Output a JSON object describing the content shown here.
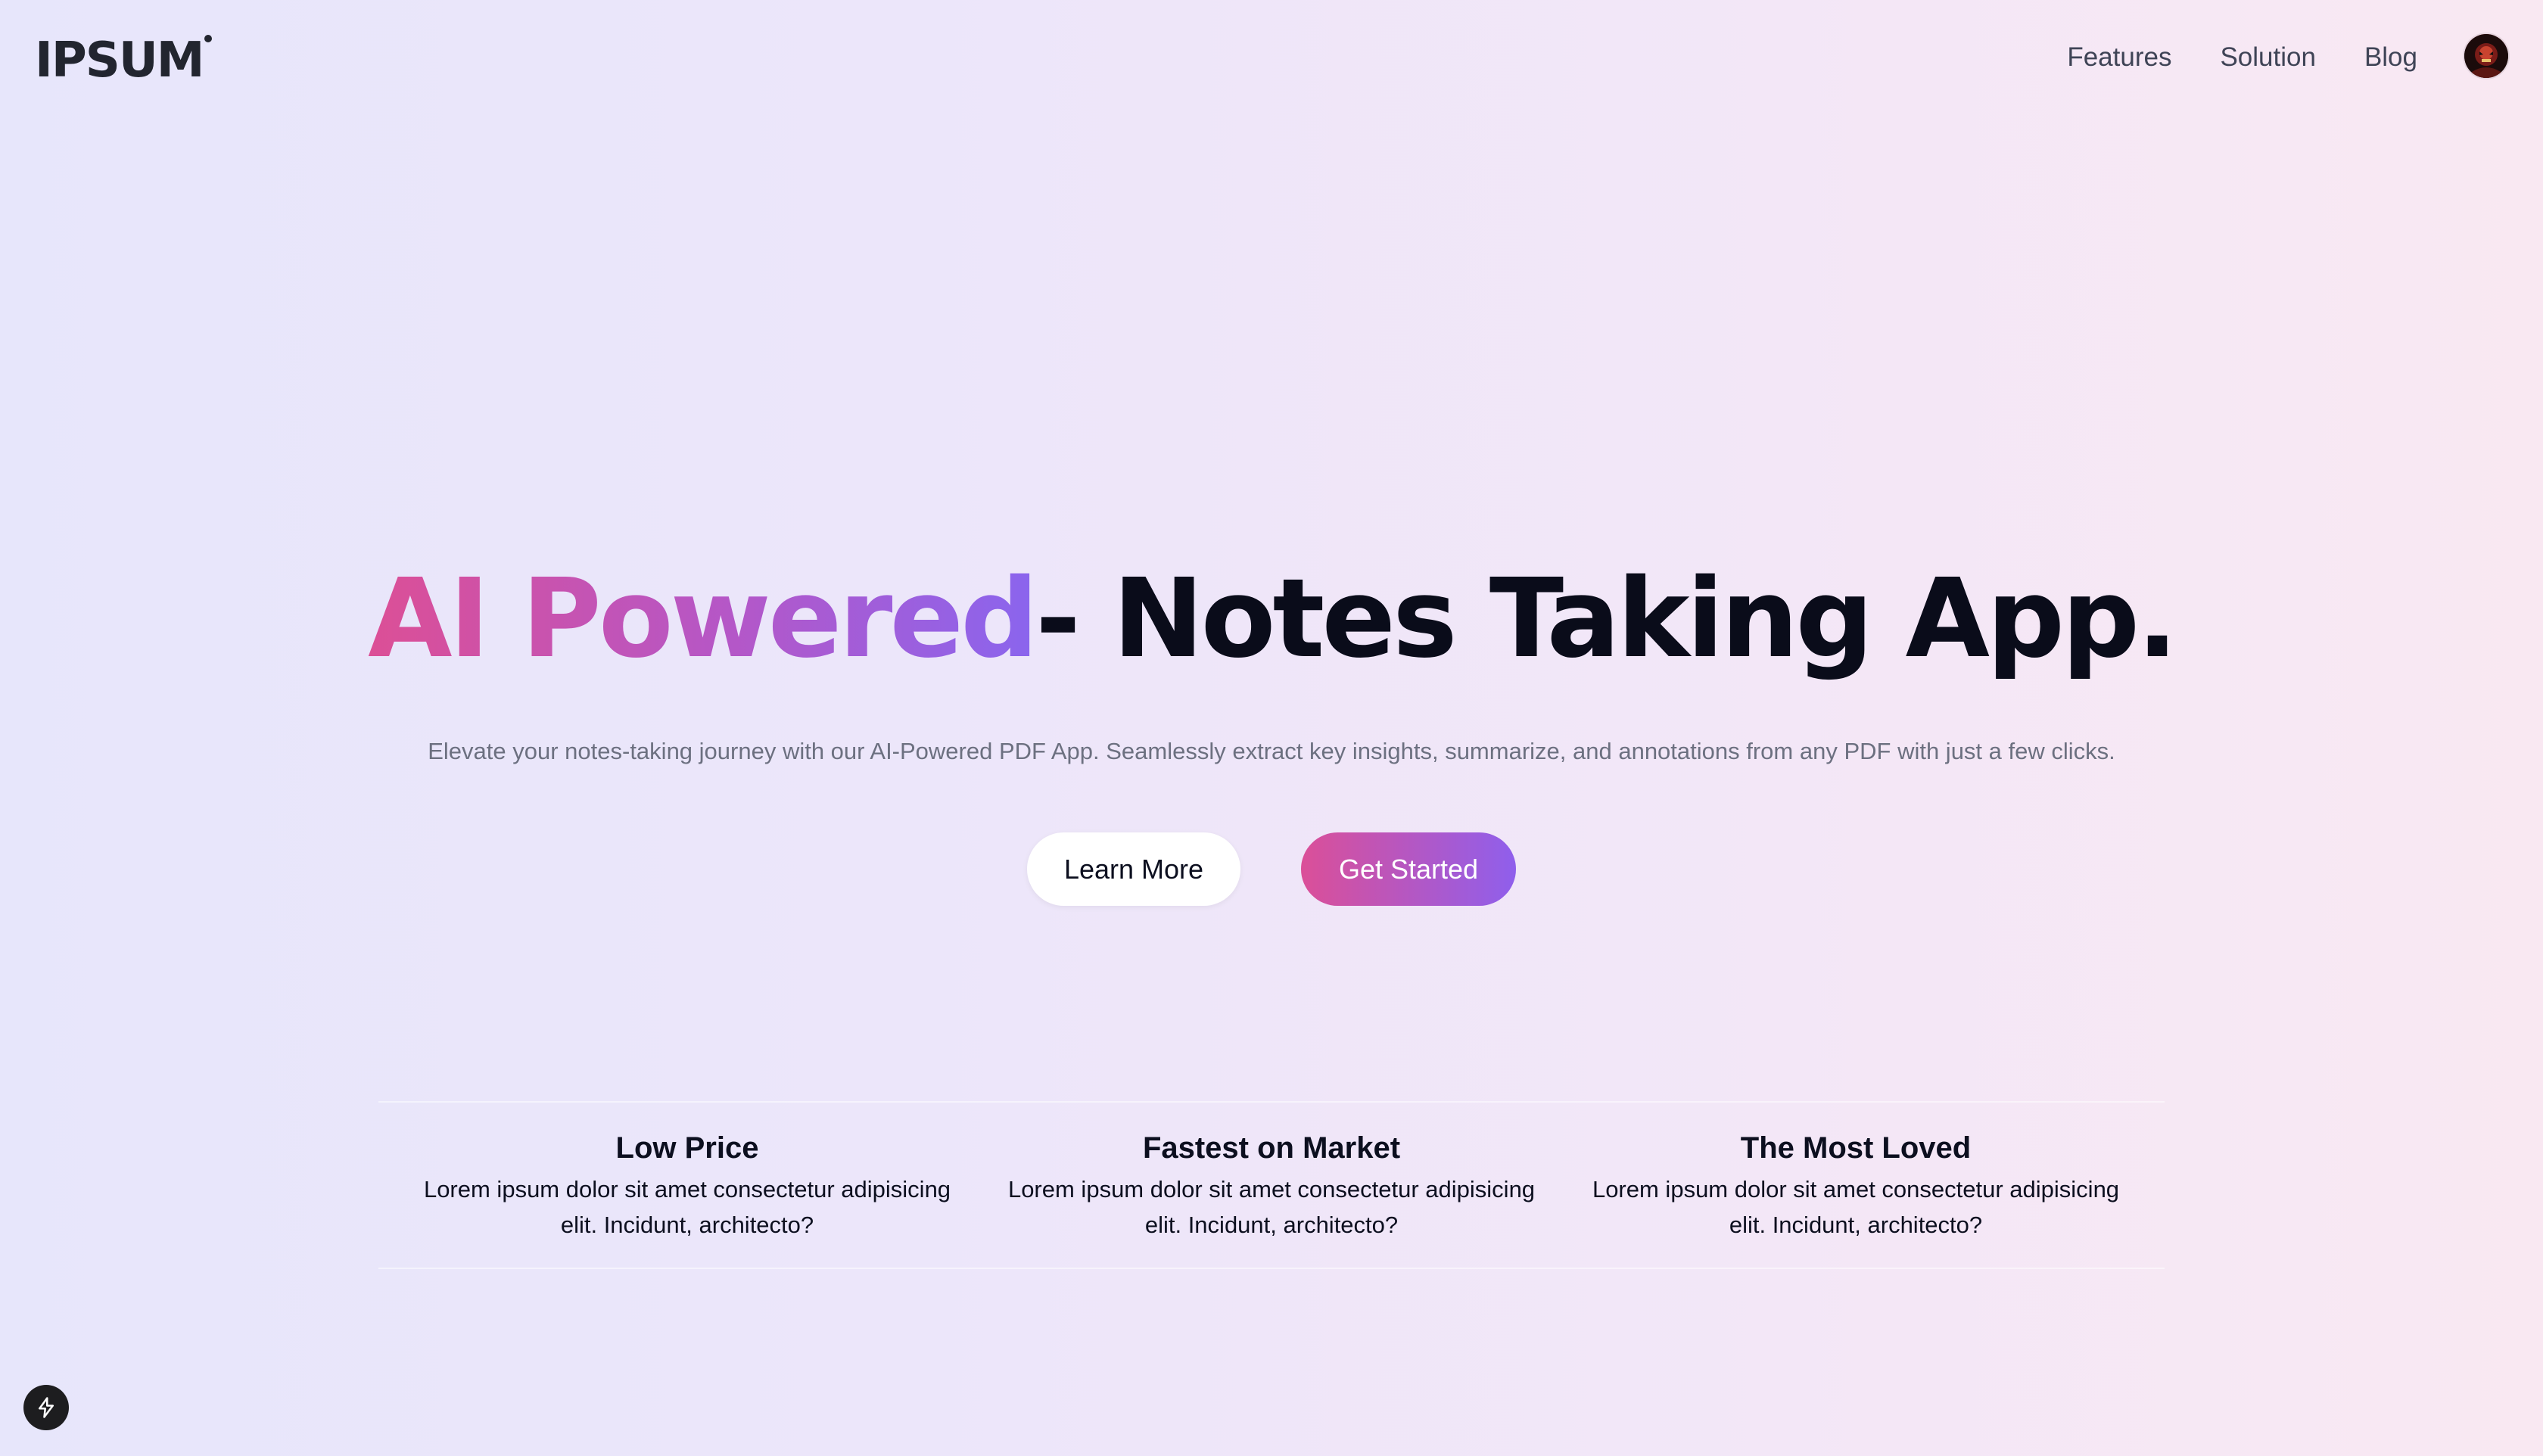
{
  "header": {
    "logo_text": "IPSUM",
    "nav": [
      {
        "label": "Features"
      },
      {
        "label": "Solution"
      },
      {
        "label": "Blog"
      }
    ]
  },
  "hero": {
    "title_highlight": "AI Powered",
    "title_rest": "- Notes Taking App.",
    "subtitle": "Elevate your notes-taking journey with our AI-Powered PDF App. Seamlessly extract key insights, summarize, and annotations from any PDF with just a few clicks.",
    "learn_more_label": "Learn More",
    "get_started_label": "Get Started"
  },
  "features": [
    {
      "title": "Low Price",
      "description": "Lorem ipsum dolor sit amet consectetur adipisicing elit. Incidunt, architecto?"
    },
    {
      "title": "Fastest on Market",
      "description": "Lorem ipsum dolor sit amet consectetur adipisicing elit. Incidunt, architecto?"
    },
    {
      "title": "The Most Loved",
      "description": "Lorem ipsum dolor sit amet consectetur adipisicing elit. Incidunt, architecto?"
    }
  ],
  "colors": {
    "gradient_start": "#dc4f96",
    "gradient_end": "#8a65ee",
    "heading_dark": "#0a0c1a"
  },
  "icons": {
    "avatar": "user-avatar",
    "badge": "lightning-bolt-icon"
  }
}
